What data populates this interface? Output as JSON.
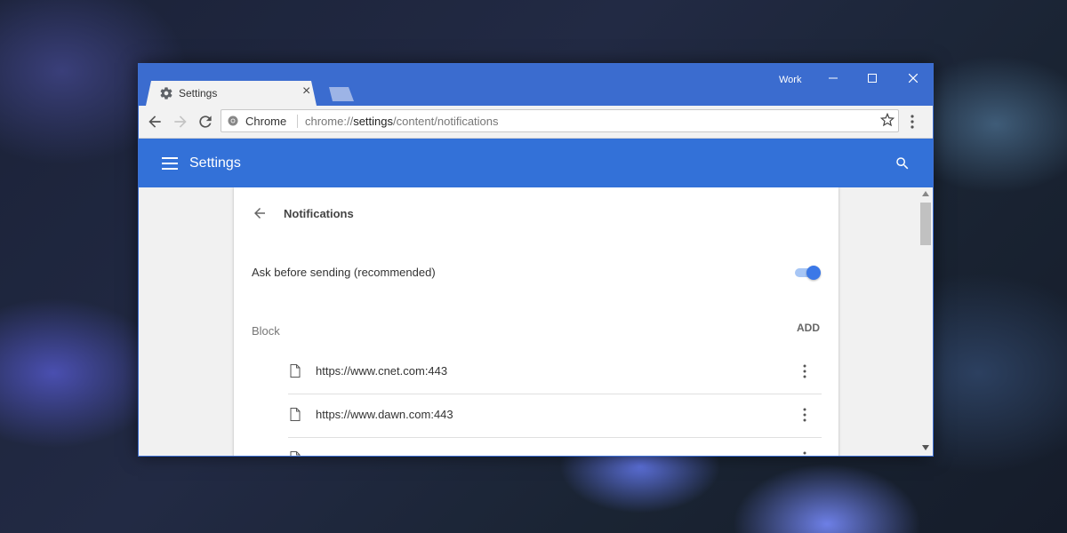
{
  "window": {
    "profile": "Work",
    "controls": {
      "minimize": "—",
      "maximize": "☐",
      "close": "✕"
    }
  },
  "tab": {
    "title": "Settings",
    "close": "×"
  },
  "omnibox": {
    "site_name": "Chrome",
    "url_scheme": "chrome://",
    "url_host": "settings",
    "url_path": "/content/notifications"
  },
  "appbar": {
    "title": "Settings"
  },
  "page": {
    "title": "Notifications",
    "ask_setting": {
      "label": "Ask before sending (recommended)",
      "enabled": true
    },
    "block": {
      "label": "Block",
      "add_label": "ADD",
      "sites": [
        {
          "url": "https://www.cnet.com:443"
        },
        {
          "url": "https://www.dawn.com:443"
        }
      ]
    }
  },
  "colors": {
    "titlebar": "#3b6ccf",
    "appbar": "#3371d8",
    "toggle_on": "#3b78e7"
  }
}
